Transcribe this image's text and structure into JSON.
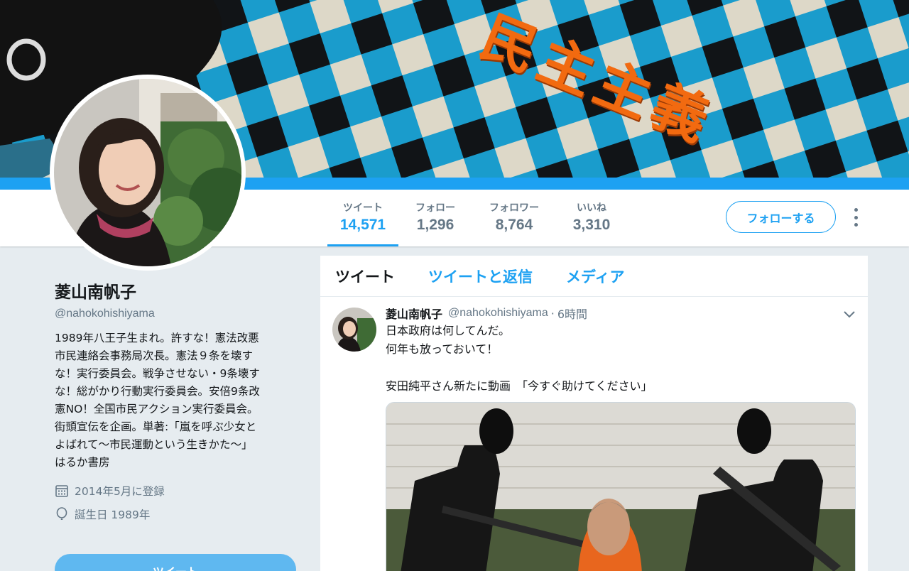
{
  "banner": {
    "text": "民主主義"
  },
  "stats": [
    {
      "label": "ツイート",
      "value": "14,571"
    },
    {
      "label": "フォロー",
      "value": "1,296"
    },
    {
      "label": "フォロワー",
      "value": "8,764"
    },
    {
      "label": "いいね",
      "value": "3,310"
    }
  ],
  "follow_button": "フォローする",
  "profile": {
    "name": "菱山南帆子",
    "handle": "@nahokohishiyama",
    "bio_lines": [
      "1989年八王子生まれ。許すな！憲法改悪",
      "市民連絡会事務局次長。憲法９条を壊す",
      "な！実行委員会。戦争させない・9条壊す",
      "な！総がかり行動実行委員会。安倍9条改",
      "憲NO！全国市民アクション実行委員会。",
      "街頭宣伝を企画。単著:「嵐を呼ぶ少女と",
      "よばれて〜市民運動という生きかた〜」",
      "はるか書房"
    ],
    "joined": "2014年5月に登録",
    "birthday": "誕生日 1989年",
    "tweet_button": "ツイート"
  },
  "tabs": [
    "ツイート",
    "ツイートと返信",
    "メディア"
  ],
  "tweet": {
    "name": "菱山南帆子",
    "handle": "@nahokohishiyama",
    "dot": "·",
    "time": "6時間",
    "lines": [
      "日本政府は何してんだ。",
      "何年も放っておいて！",
      "",
      "安田純平さん新たに動画　「今すぐ助けてください」"
    ]
  },
  "colors": {
    "accent": "#1da1f2",
    "text": "#14171a",
    "muted": "#657786",
    "banner_text": "#f26a10"
  }
}
